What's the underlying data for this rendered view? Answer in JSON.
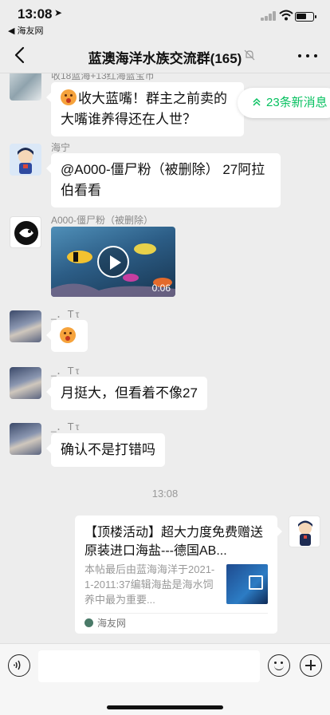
{
  "status_bar": {
    "time": "13:08",
    "location_icon": "location-arrow-icon",
    "back_app_label": "◀ 海友网",
    "icons": [
      "signal-icon",
      "wifi-icon",
      "battery-icon"
    ]
  },
  "header": {
    "title": "蓝澳海洋水族交流群(165)",
    "back_icon": "chevron-left-icon",
    "mute_icon": "bell-muted-icon",
    "more_icon": "more-dots-icon"
  },
  "new_messages_pill": {
    "label": "23条新消息",
    "icon": "double-chevron-up-icon"
  },
  "messages": [
    {
      "sender": "收18蓝海+13红海蓝宝币",
      "text": "收大蓝嘴！群主之前卖的大嘴谁养得还在人世？",
      "has_emoji": true
    },
    {
      "sender": "海宁",
      "text": "@A000-僵尸粉（被删除） 27阿拉伯看看"
    },
    {
      "sender": "A000-僵尸粉（被删除）",
      "video_duration": "0:06"
    },
    {
      "sender": "_．Ｔτ",
      "text": "",
      "has_emoji": true
    },
    {
      "sender": "_．Ｔτ",
      "text": "月挺大，但看着不像27"
    },
    {
      "sender": "_．Ｔτ",
      "text": "确认不是打错吗"
    }
  ],
  "timestamp": "13:08",
  "link_card": {
    "title": "【顶楼活动】超大力度免费赠送原装进口海盐---德国AB...",
    "description": "本帖最后由蓝海海洋于2021-1-2011:37编辑海盐是海水饲养中最为重要...",
    "source": "海友网"
  },
  "input_bar": {
    "voice_icon": "voice-icon",
    "emoji_icon": "emoji-icon",
    "plus_icon": "plus-icon",
    "input_value": ""
  }
}
